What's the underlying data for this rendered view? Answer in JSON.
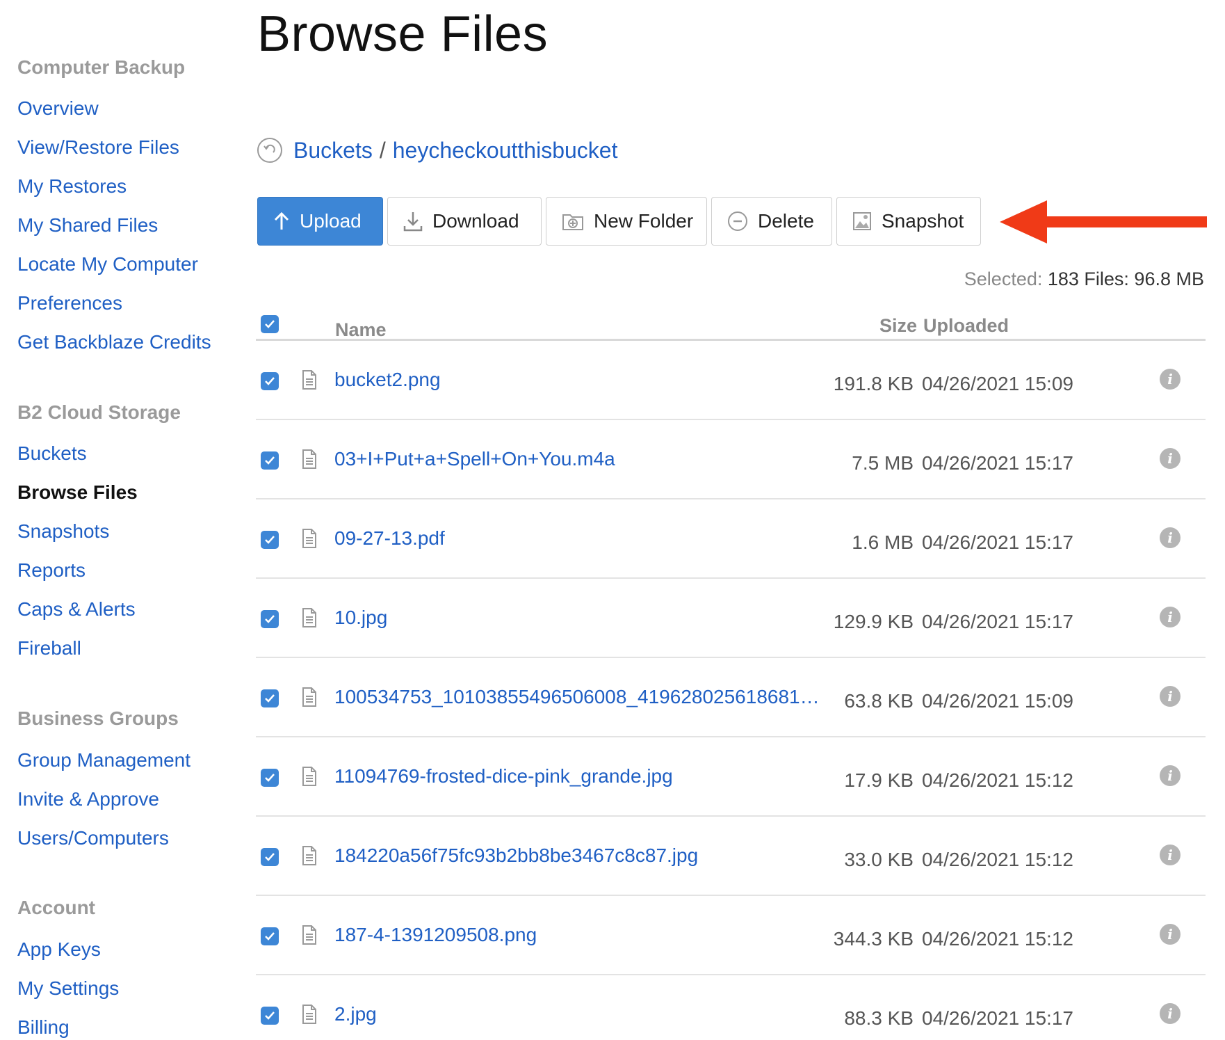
{
  "sidebar": {
    "sections": [
      {
        "title": "Computer Backup",
        "items": [
          "Overview",
          "View/Restore Files",
          "My Restores",
          "My Shared Files",
          "Locate My Computer",
          "Preferences",
          "Get Backblaze Credits"
        ]
      },
      {
        "title": "B2 Cloud Storage",
        "items": [
          "Buckets",
          "Browse Files",
          "Snapshots",
          "Reports",
          "Caps & Alerts",
          "Fireball"
        ]
      },
      {
        "title": "Business Groups",
        "items": [
          "Group Management",
          "Invite & Approve",
          "Users/Computers"
        ]
      },
      {
        "title": "Account",
        "items": [
          "App Keys",
          "My Settings",
          "Billing"
        ]
      }
    ],
    "active_item": "Browse Files"
  },
  "page": {
    "title": "Browse Files"
  },
  "breadcrumb": {
    "root": "Buckets",
    "separator": "/",
    "bucket": "heycheckoutthisbucket",
    "back_icon": "back-arrow-icon"
  },
  "toolbar": {
    "upload": "Upload",
    "download": "Download",
    "new_folder": "New Folder",
    "delete": "Delete",
    "snapshot": "Snapshot"
  },
  "selected": {
    "label": "Selected:",
    "value": "183 Files: 96.8 MB"
  },
  "table": {
    "columns": {
      "name": "Name",
      "size": "Size",
      "uploaded": "Uploaded"
    },
    "rows": [
      {
        "name": "bucket2.png",
        "size": "191.8 KB",
        "uploaded": "04/26/2021 15:09",
        "checked": true
      },
      {
        "name": "03+I+Put+a+Spell+On+You.m4a",
        "size": "7.5 MB",
        "uploaded": "04/26/2021 15:17",
        "checked": true
      },
      {
        "name": "09-27-13.pdf",
        "size": "1.6 MB",
        "uploaded": "04/26/2021 15:17",
        "checked": true
      },
      {
        "name": "10.jpg",
        "size": "129.9 KB",
        "uploaded": "04/26/2021 15:17",
        "checked": true
      },
      {
        "name": "100534753_10103855496506008_419628025618681…",
        "size": "63.8 KB",
        "uploaded": "04/26/2021 15:09",
        "checked": true
      },
      {
        "name": "11094769-frosted-dice-pink_grande.jpg",
        "size": "17.9 KB",
        "uploaded": "04/26/2021 15:12",
        "checked": true
      },
      {
        "name": "184220a56f75fc93b2bb8be3467c8c87.jpg",
        "size": "33.0 KB",
        "uploaded": "04/26/2021 15:12",
        "checked": true
      },
      {
        "name": "187-4-1391209508.png",
        "size": "344.3 KB",
        "uploaded": "04/26/2021 15:12",
        "checked": true
      },
      {
        "name": "2.jpg",
        "size": "88.3 KB",
        "uploaded": "04/26/2021 15:17",
        "checked": true
      }
    ]
  },
  "colors": {
    "link": "#1f5fc4",
    "primary": "#3d86d6",
    "arrow": "#f03a17",
    "muted": "#9a9a9a"
  }
}
